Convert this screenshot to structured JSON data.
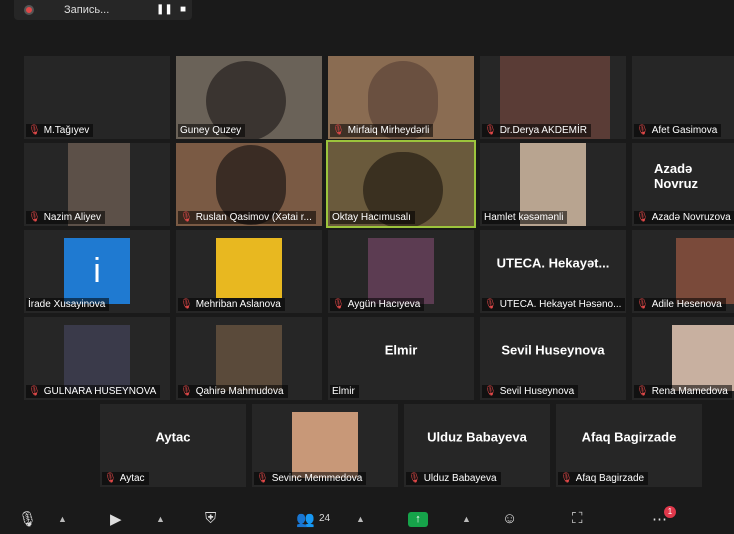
{
  "recording": {
    "label": "Запись..."
  },
  "participants": [
    {
      "name": "M.Tağıyev",
      "center": ""
    },
    {
      "name": "Guney Quzey",
      "center": ""
    },
    {
      "name": "Mirfaiq Mirheydərli",
      "center": ""
    },
    {
      "name": "Dr.Derya AKDEMİR",
      "center": ""
    },
    {
      "name": "Afet Gasimova",
      "center": ""
    },
    {
      "name": "Nazim Aliyev",
      "center": ""
    },
    {
      "name": "Ruslan Qasimov (Xətai r...",
      "center": ""
    },
    {
      "name": "Oktay Hacımusalı",
      "center": ""
    },
    {
      "name": "Hamlet kəsəmənli",
      "center": ""
    },
    {
      "name": "Azadə Novruzova",
      "center": "Azadə Novruz"
    },
    {
      "name": "İrade Xusayinova",
      "center": ""
    },
    {
      "name": "Mehriban Aslanova",
      "center": ""
    },
    {
      "name": "Aygün Hacıyeva",
      "center": ""
    },
    {
      "name": "UTECA. Hekayət Həsəno...",
      "center": "UTECA. Hekayət..."
    },
    {
      "name": "Adile Hesenova",
      "center": ""
    },
    {
      "name": "GULNARA HUSEYNOVA",
      "center": ""
    },
    {
      "name": "Qahirə Mahmudova",
      "center": ""
    },
    {
      "name": "Elmir",
      "center": "Elmir"
    },
    {
      "name": "Sevil Huseynova",
      "center": "Sevil Huseynova"
    },
    {
      "name": "Rena Mamedova",
      "center": ""
    },
    {
      "name": "Aytac",
      "center": "Aytac"
    },
    {
      "name": "Sevinc Memmedova",
      "center": ""
    },
    {
      "name": "Ulduz Babayeva",
      "center": "Ulduz Babayeva"
    },
    {
      "name": "Afaq Bagirzade",
      "center": "Afaq Bagirzade"
    }
  ],
  "toolbar": {
    "participants_count": "24",
    "notification_count": "1"
  },
  "colors": {
    "active_speaker": "#9cc43c",
    "mic_off": "#e04848",
    "share": "#16a34a"
  }
}
